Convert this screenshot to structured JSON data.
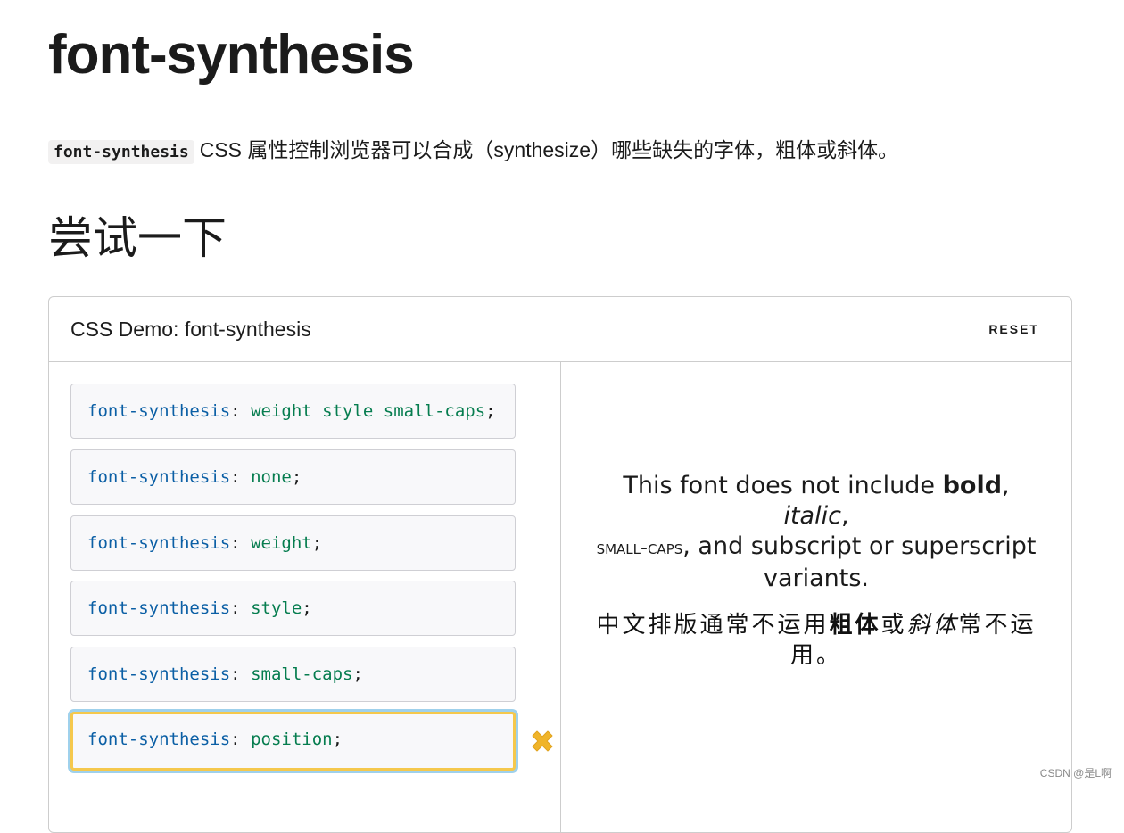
{
  "page": {
    "title": "font-synthesis",
    "intro_code": "font-synthesis",
    "intro_text": "CSS 属性控制浏览器可以合成（synthesize）哪些缺失的字体，粗体或斜体。",
    "section_title": "尝试一下"
  },
  "demo": {
    "title": "CSS Demo: font-synthesis",
    "reset_label": "RESET",
    "options": [
      {
        "property": "font-synthesis",
        "colon": ":",
        "value": "weight style small-caps",
        "semicolon": ";"
      },
      {
        "property": "font-synthesis",
        "colon": ":",
        "value": "none",
        "semicolon": ";"
      },
      {
        "property": "font-synthesis",
        "colon": ":",
        "value": "weight",
        "semicolon": ";"
      },
      {
        "property": "font-synthesis",
        "colon": ":",
        "value": "style",
        "semicolon": ";"
      },
      {
        "property": "font-synthesis",
        "colon": ":",
        "value": "small-caps",
        "semicolon": ";"
      },
      {
        "property": "font-synthesis",
        "colon": ":",
        "value": "position",
        "semicolon": ";"
      }
    ],
    "selected_index": 5,
    "invalid_icon": "x-mark-icon",
    "invalid_color": "#f0b429",
    "preview": {
      "en_1": "This font does not include ",
      "en_bold": "bold",
      "en_2": ", ",
      "en_italic": "italic",
      "en_3": ",",
      "en_smallcaps": "small-caps",
      "en_4": ", and subscript or superscript variants.",
      "zh_1": "中文排版通常不运用",
      "zh_bold": "粗体",
      "zh_2": "或",
      "zh_italic": "斜体",
      "zh_3": "常不运用。"
    }
  },
  "watermark": "CSDN @是L啊"
}
